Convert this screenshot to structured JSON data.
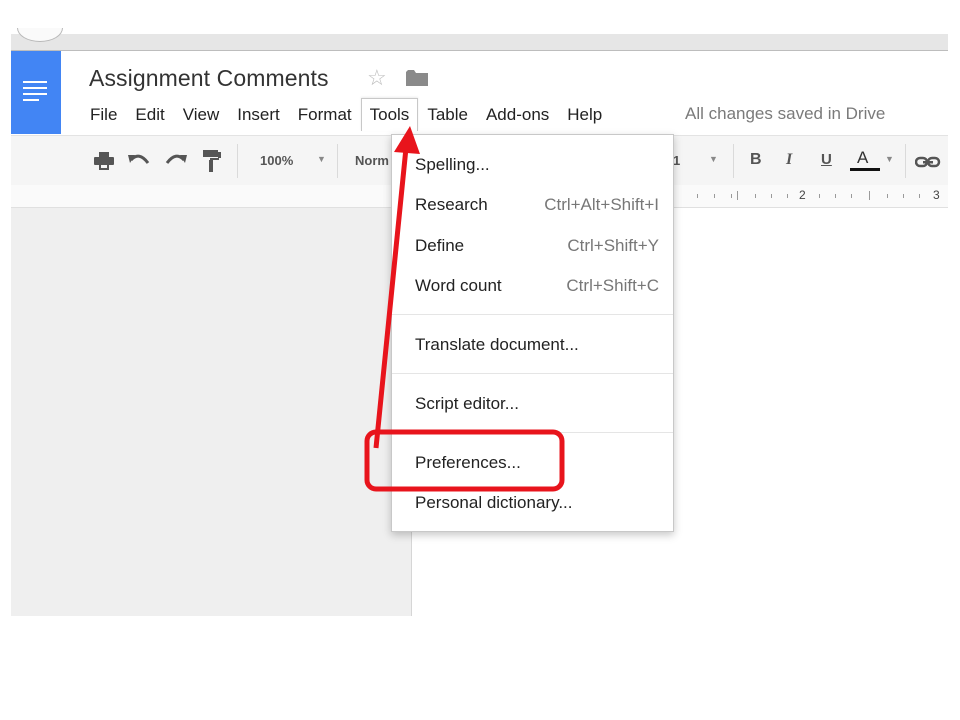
{
  "document": {
    "title": "Assignment Comments",
    "save_status": "All changes saved in Drive"
  },
  "menubar": {
    "items": [
      {
        "label": "File"
      },
      {
        "label": "Edit"
      },
      {
        "label": "View"
      },
      {
        "label": "Insert"
      },
      {
        "label": "Format"
      },
      {
        "label": "Tools",
        "open": true
      },
      {
        "label": "Table"
      },
      {
        "label": "Add-ons"
      },
      {
        "label": "Help"
      }
    ]
  },
  "toolbar": {
    "zoom": "100%",
    "style": "Norm",
    "font_size": "1",
    "bold": "B",
    "italic": "I",
    "underline": "U",
    "text_color": "A"
  },
  "ruler": {
    "numbers": [
      "2",
      "3"
    ]
  },
  "tools_menu": {
    "items": [
      {
        "label": "Spelling...",
        "shortcut": ""
      },
      {
        "label": "Research",
        "shortcut": "Ctrl+Alt+Shift+I"
      },
      {
        "label": "Define",
        "shortcut": "Ctrl+Shift+Y"
      },
      {
        "label": "Word count",
        "shortcut": "Ctrl+Shift+C"
      },
      {
        "label": "Translate document...",
        "shortcut": ""
      },
      {
        "label": "Script editor...",
        "shortcut": ""
      },
      {
        "label": "Preferences...",
        "shortcut": "",
        "highlighted": true
      },
      {
        "label": "Personal dictionary...",
        "shortcut": ""
      }
    ]
  },
  "colors": {
    "docs_blue": "#4285f4",
    "annotation_red": "#e8141c"
  },
  "icons": [
    "docs-logo-icon",
    "star-icon",
    "folder-icon",
    "print-icon",
    "undo-icon",
    "redo-icon",
    "paint-format-icon",
    "link-icon"
  ]
}
